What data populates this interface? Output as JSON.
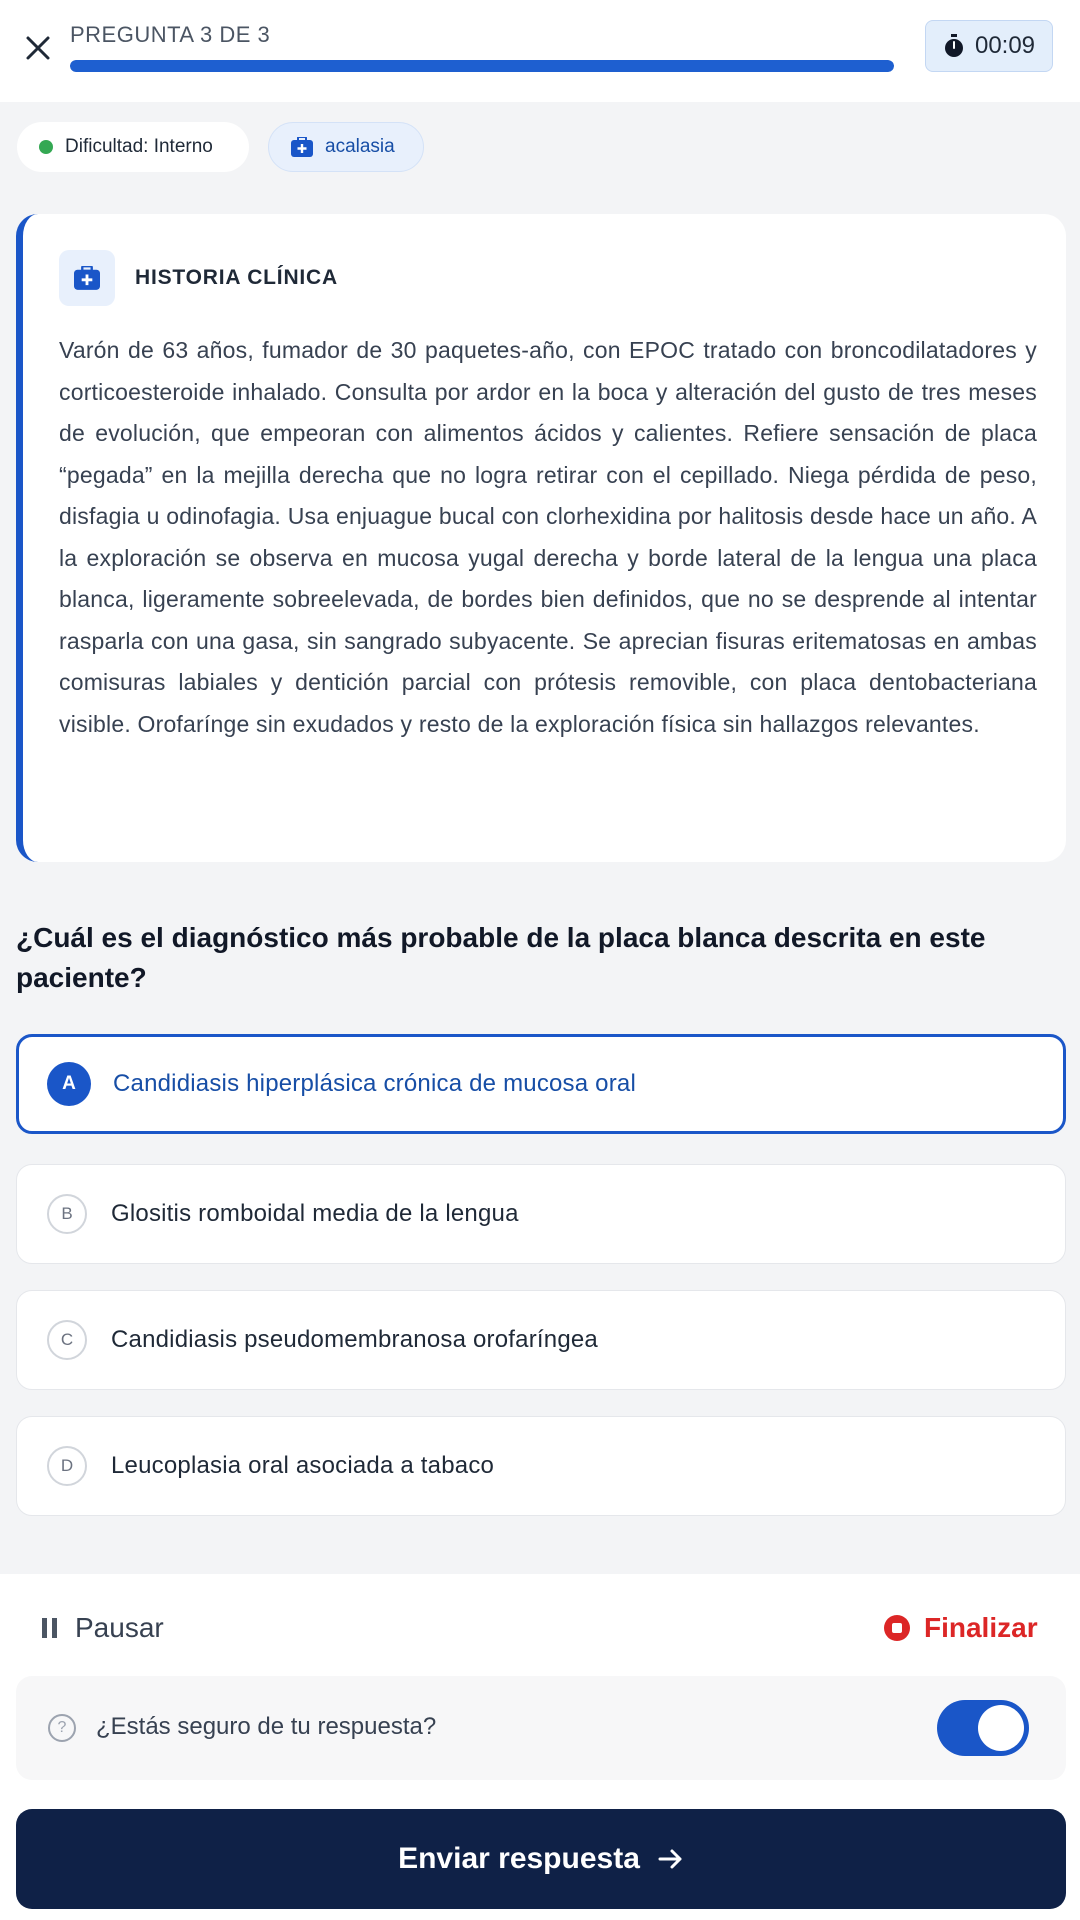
{
  "header": {
    "progress_label": "PREGUNTA 3 DE 3",
    "progress_fraction": 1.0,
    "timer": "00:09",
    "close_icon": "close-icon",
    "timer_icon": "stopwatch-icon",
    "accent_color": "#1a56c8"
  },
  "chips": {
    "difficulty": "Dificultad: Interno",
    "difficulty_dot_color": "#34a853",
    "topic": "acalasia",
    "topic_icon": "medical-kit-icon"
  },
  "case": {
    "title": "HISTORIA CLÍNICA",
    "icon": "medical-kit-icon",
    "body": "Varón de 63 años, fumador de 30 paquetes-año, con EPOC tratado con broncodilatadores y corticoesteroide inhalado. Consulta por ardor en la boca y alteración del gusto de tres meses de evolución, que empeoran con alimentos ácidos y calientes. Refiere sensación de placa “pegada” en la mejilla derecha que no logra retirar con el cepillado. Niega pérdida de peso, disfagia u odinofagia. Usa enjuague bucal con clorhexidina por halitosis desde hace un año. A la exploración se observa en mucosa yugal derecha y borde lateral de la lengua una placa blanca, ligeramente sobreelevada, de bordes bien definidos, que no se desprende al intentar rasparla con una gasa, sin sangrado subyacente. Se aprecian fisuras eritematosas en ambas comisuras labiales y dentición parcial con prótesis removible, con placa dentobacteriana visible. Orofarínge sin exudados y resto de la exploración física sin hallazgos relevantes."
  },
  "question": "¿Cuál es el diagnóstico más probable de la placa blanca descrita en este paciente?",
  "options": [
    {
      "letter": "A",
      "text": "Candidiasis hiperplásica crónica de mucosa oral",
      "selected": true
    },
    {
      "letter": "B",
      "text": "Glositis romboidal media de la lengua",
      "selected": false
    },
    {
      "letter": "C",
      "text": "Candidiasis pseudomembranosa orofaríngea",
      "selected": false
    },
    {
      "letter": "D",
      "text": "Leucoplasia oral asociada a tabaco",
      "selected": false
    }
  ],
  "footer": {
    "pause_label": "Pausar",
    "pause_icon": "pause-icon",
    "finish_label": "Finalizar",
    "finish_icon": "stop-icon",
    "finish_color": "#dc2626",
    "confirm_text": "¿Estás seguro de tu respuesta?",
    "confirm_icon": "help-icon",
    "confirm_toggle_on": true,
    "submit_label": "Enviar respuesta",
    "submit_icon": "arrow-right-icon",
    "submit_color": "#0f2147"
  }
}
